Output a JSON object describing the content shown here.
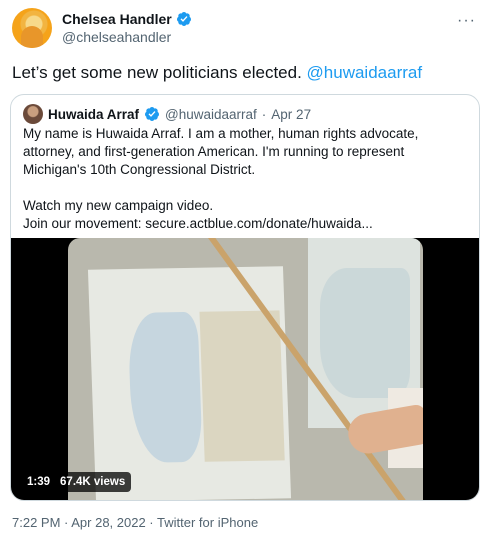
{
  "author": {
    "name": "Chelsea Handler",
    "handle": "@chelseahandler",
    "more": "···"
  },
  "tweet": {
    "text": "Let’s get some new politicians elected. ",
    "mention": "@huwaidaarraf"
  },
  "quote": {
    "name": "Huwaida Arraf",
    "handle": "@huwaidaarraf",
    "separator": "·",
    "date": "Apr 27",
    "line1": "My name is Huwaida Arraf. I am a mother, human rights advocate, attorney, and first-generation American. I'm running to represent Michigan's 10th Congressional District.",
    "line2": "Watch my new campaign video.",
    "line3": "Join our movement: secure.actblue.com/donate/huwaida...",
    "video": {
      "duration": "1:39",
      "views": "67.4K views"
    }
  },
  "footer": {
    "text": "7:22 PM · Apr 28, 2022 · Twitter for iPhone"
  },
  "colors": {
    "accent": "#1d9bf0",
    "muted": "#536471",
    "border": "#cfd9de"
  },
  "icons": [
    "verified-badge-icon",
    "more-options-icon"
  ]
}
